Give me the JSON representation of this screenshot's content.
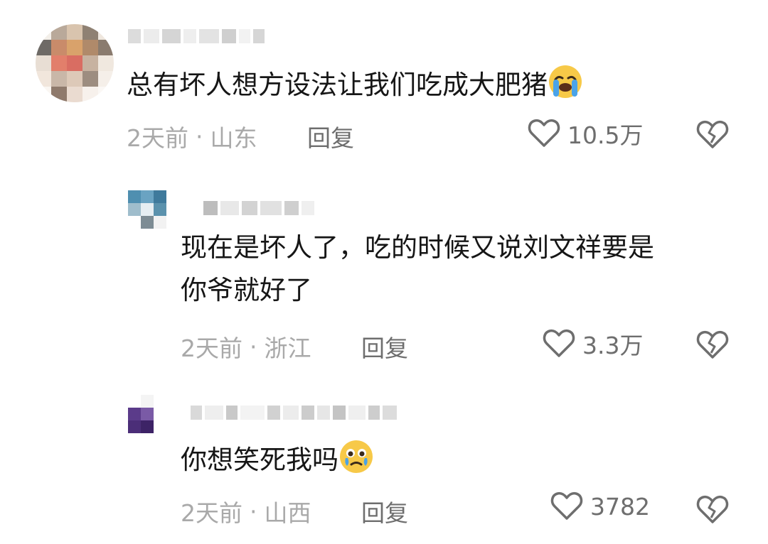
{
  "comments": [
    {
      "text": "总有坏人想方设法让我们吃成大肥猪",
      "emoji": "loudly-crying-face",
      "time": "2天前",
      "separator": "·",
      "location": "山东",
      "reply_label": "回复",
      "likes": "10.5万"
    },
    {
      "text_line1": "现在是坏人了，吃的时候又说刘文祥要是",
      "text_line2": "你爷就好了",
      "time": "2天前",
      "separator": "·",
      "location": "浙江",
      "reply_label": "回复",
      "likes": "3.3万"
    },
    {
      "text": "你想笑死我吗",
      "emoji": "face-holding-back-tears",
      "time": "2天前",
      "separator": "·",
      "location": "山西",
      "reply_label": "回复",
      "likes": "3782"
    }
  ],
  "icons": {
    "like": "heart-outline-icon",
    "dislike": "broken-heart-icon"
  },
  "colors": {
    "text": "#161616",
    "meta": "#a9a9a9",
    "action": "#6e6e6e",
    "emoji_yellow": "#f7c948",
    "emoji_tears": "#4aa3e8"
  }
}
